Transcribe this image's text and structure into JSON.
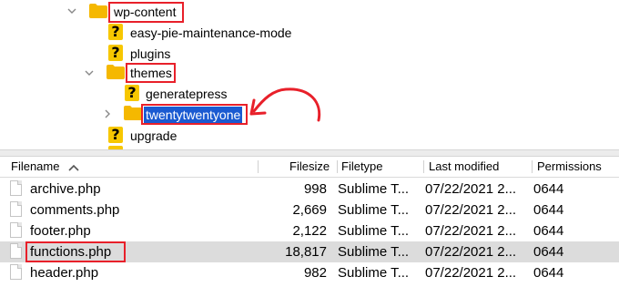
{
  "tree": {
    "items": [
      {
        "label": "wp-content",
        "icon": "folder-icon"
      },
      {
        "label": "easy-pie-maintenance-mode",
        "icon": "unknown-icon"
      },
      {
        "label": "plugins",
        "icon": "unknown-icon"
      },
      {
        "label": "themes",
        "icon": "folder-icon"
      },
      {
        "label": "generatepress",
        "icon": "unknown-icon"
      },
      {
        "label": "twentytwentyone",
        "icon": "folder-icon"
      },
      {
        "label": "upgrade",
        "icon": "unknown-icon"
      }
    ],
    "unknown_glyph": "?"
  },
  "filelist": {
    "columns": [
      "Filename",
      "Filesize",
      "Filetype",
      "Last modified",
      "Permissions"
    ],
    "rows": [
      {
        "name": "archive.php",
        "size": "998",
        "type": "Sublime T...",
        "modified": "07/22/2021 2...",
        "perms": "0644"
      },
      {
        "name": "comments.php",
        "size": "2,669",
        "type": "Sublime T...",
        "modified": "07/22/2021 2...",
        "perms": "0644"
      },
      {
        "name": "footer.php",
        "size": "2,122",
        "type": "Sublime T...",
        "modified": "07/22/2021 2...",
        "perms": "0644"
      },
      {
        "name": "functions.php",
        "size": "18,817",
        "type": "Sublime T...",
        "modified": "07/22/2021 2...",
        "perms": "0644"
      },
      {
        "name": "header.php",
        "size": "982",
        "type": "Sublime T...",
        "modified": "07/22/2021 2...",
        "perms": "0644"
      }
    ]
  },
  "colors": {
    "highlight_box": "#e8202a",
    "selection": "#1a5ad1",
    "folder": "#f5b800",
    "arrow": "#e8202a"
  }
}
